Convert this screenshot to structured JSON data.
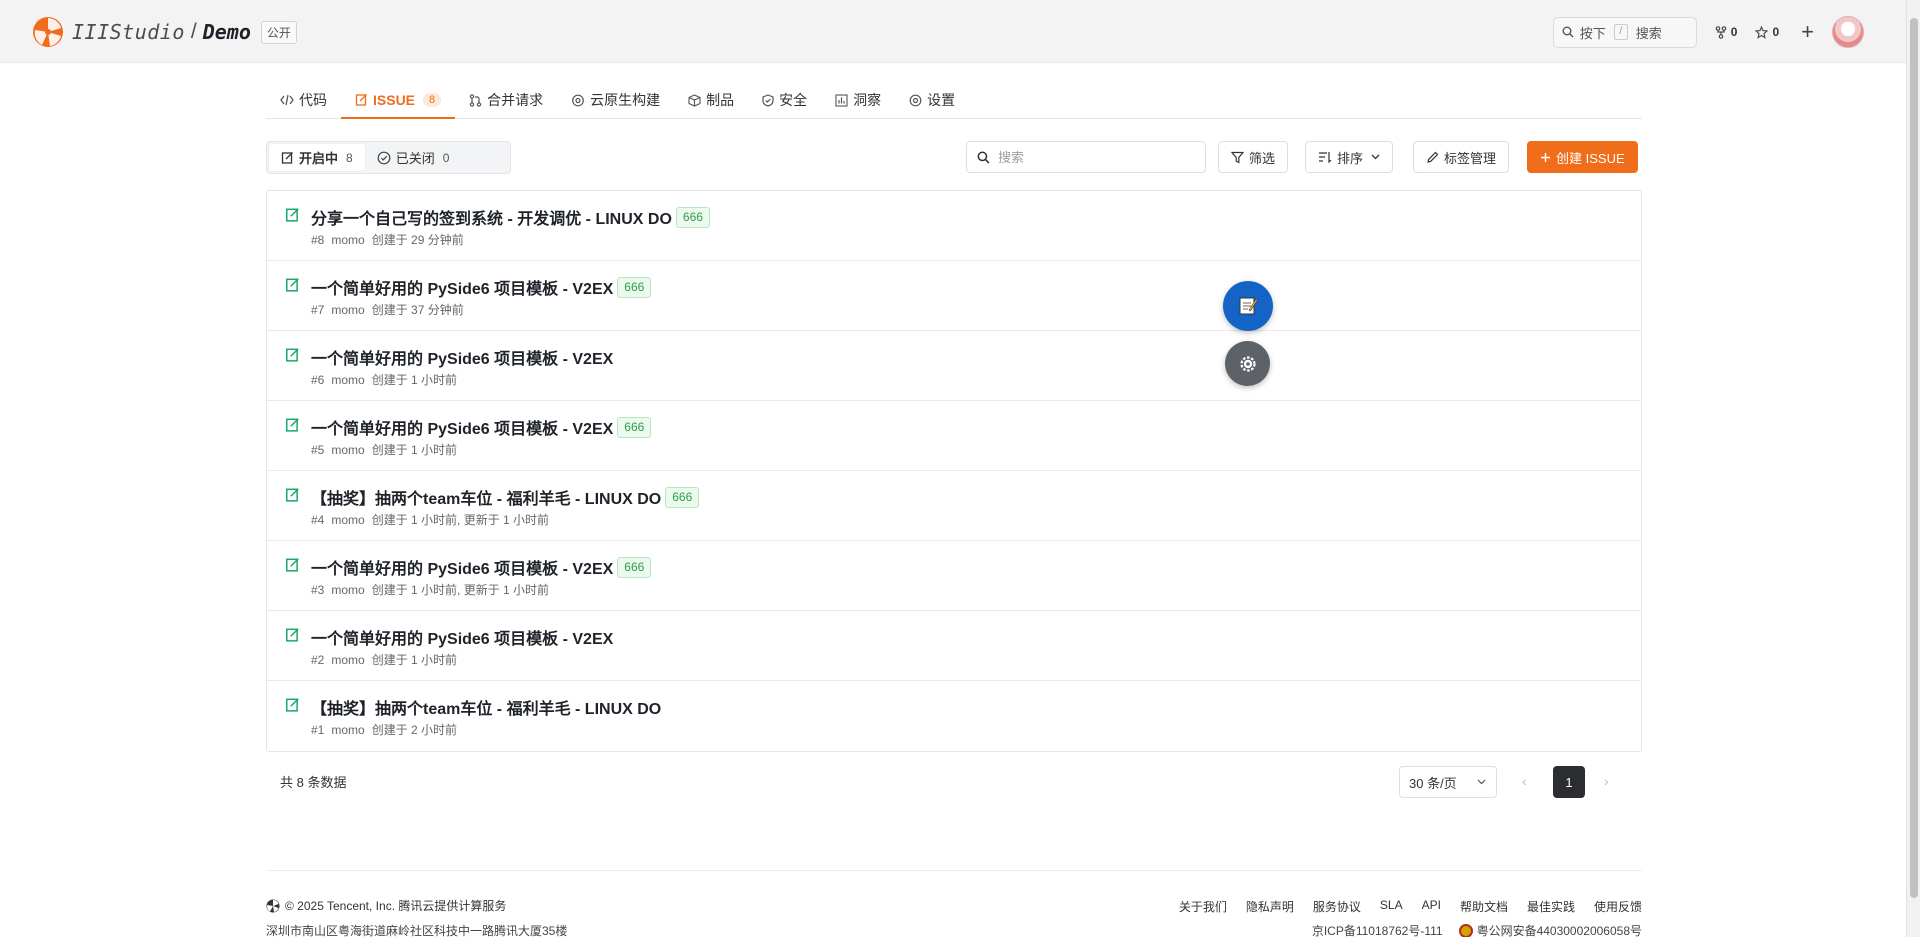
{
  "header": {
    "owner": "IIIStudio",
    "separator": "/",
    "repo": "Demo",
    "visibility": "公开",
    "search_press": "按下",
    "search_key": "/",
    "search_label": "搜索",
    "forks": "0",
    "stars": "0",
    "brand_color": "#ef6c1e"
  },
  "tabs": [
    {
      "label": "代码",
      "icon": "code-icon"
    },
    {
      "label": "ISSUE",
      "icon": "issue-icon",
      "count": "8"
    },
    {
      "label": "合并请求",
      "icon": "merge-request-icon"
    },
    {
      "label": "云原生构建",
      "icon": "cloud-build-icon"
    },
    {
      "label": "制品",
      "icon": "package-icon"
    },
    {
      "label": "安全",
      "icon": "shield-icon"
    },
    {
      "label": "洞察",
      "icon": "insight-icon"
    },
    {
      "label": "设置",
      "icon": "gear-icon"
    }
  ],
  "filters": {
    "open_label": "开启中",
    "open_count": "8",
    "closed_label": "已关闭",
    "closed_count": "0",
    "search_placeholder": "搜索",
    "filter_label": "筛选",
    "sort_label": "排序",
    "labels_label": "标签管理",
    "create_label": "创建 ISSUE"
  },
  "issues": [
    {
      "title": "分享一个自己写的签到系统 - 开发调优 - LINUX DO",
      "label": "666",
      "num": "#8",
      "author": "momo",
      "time": "创建于 29 分钟前"
    },
    {
      "title": "一个简单好用的 PySide6 项目模板 - V2EX",
      "label": "666",
      "num": "#7",
      "author": "momo",
      "time": "创建于 37 分钟前"
    },
    {
      "title": "一个简单好用的 PySide6 项目模板 - V2EX",
      "label": "",
      "num": "#6",
      "author": "momo",
      "time": "创建于 1 小时前"
    },
    {
      "title": "一个简单好用的 PySide6 项目模板 - V2EX",
      "label": "666",
      "num": "#5",
      "author": "momo",
      "time": "创建于 1 小时前"
    },
    {
      "title": "【抽奖】抽两个team车位 - 福利羊毛 - LINUX DO",
      "label": "666",
      "num": "#4",
      "author": "momo",
      "time": "创建于 1 小时前, 更新于 1 小时前"
    },
    {
      "title": "一个简单好用的 PySide6 项目模板 - V2EX",
      "label": "666",
      "num": "#3",
      "author": "momo",
      "time": "创建于 1 小时前, 更新于 1 小时前"
    },
    {
      "title": "一个简单好用的 PySide6 项目模板 - V2EX",
      "label": "",
      "num": "#2",
      "author": "momo",
      "time": "创建于 1 小时前"
    },
    {
      "title": "【抽奖】抽两个team车位 - 福利羊毛 - LINUX DO",
      "label": "",
      "num": "#1",
      "author": "momo",
      "time": "创建于 2 小时前"
    }
  ],
  "pagination": {
    "total": "共 8 条数据",
    "page_size": "30 条/页",
    "current": "1"
  },
  "footer": {
    "copyright": "© 2025 Tencent, Inc. 腾讯云提供计算服务",
    "address": "深圳市南山区粤海街道麻岭社区科技中一路腾讯大厦35楼",
    "links": [
      "关于我们",
      "隐私声明",
      "服务协议",
      "SLA",
      "API",
      "帮助文档",
      "最佳实践",
      "使用反馈"
    ],
    "icp": "京ICP备11018762号-111",
    "police": "粤公网安备44030002006058号"
  }
}
